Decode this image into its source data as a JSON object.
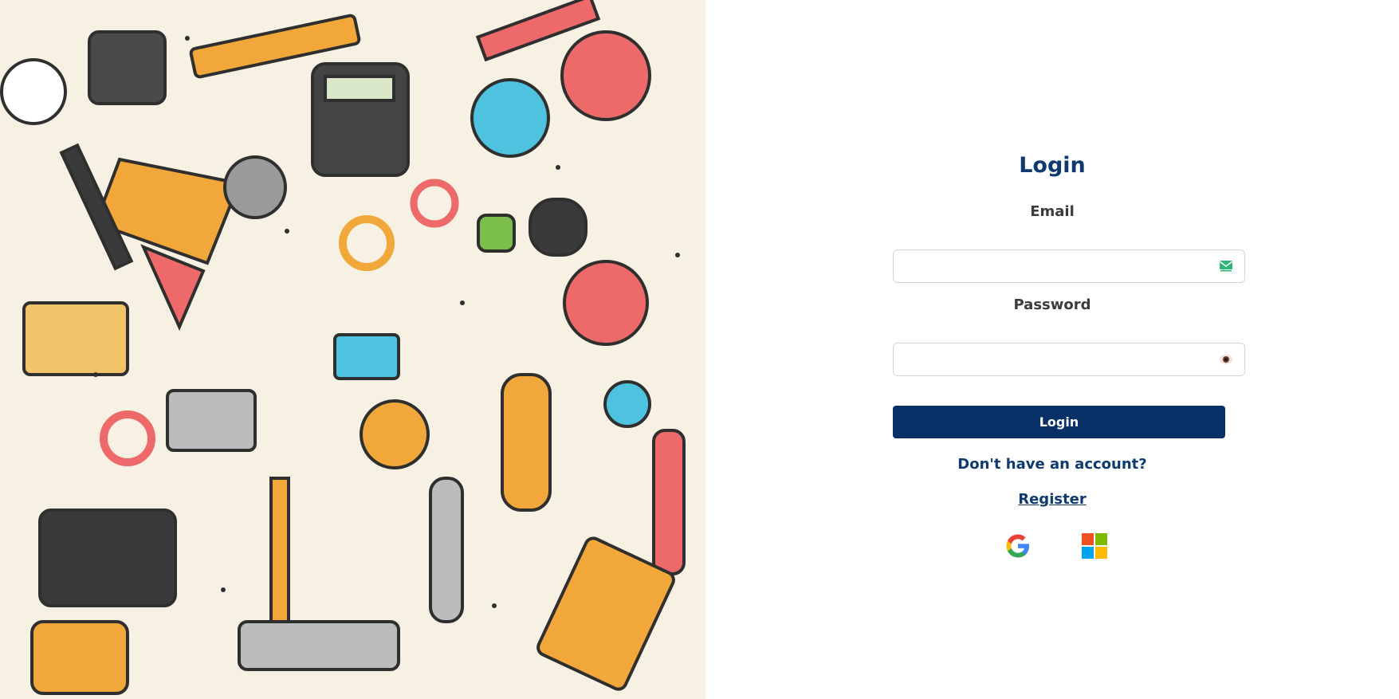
{
  "login": {
    "title": "Login",
    "email_label": "Email",
    "email_value": "",
    "password_label": "Password",
    "password_value": "",
    "submit_label": "Login",
    "no_account_prompt": "Don't have an account?",
    "register_link": "Register"
  },
  "social": {
    "providers": [
      "google-icon",
      "microsoft-icon"
    ]
  },
  "colors": {
    "brand": "#0a3068",
    "heading": "#0e3a6e",
    "email_icon": "#2bb673"
  }
}
